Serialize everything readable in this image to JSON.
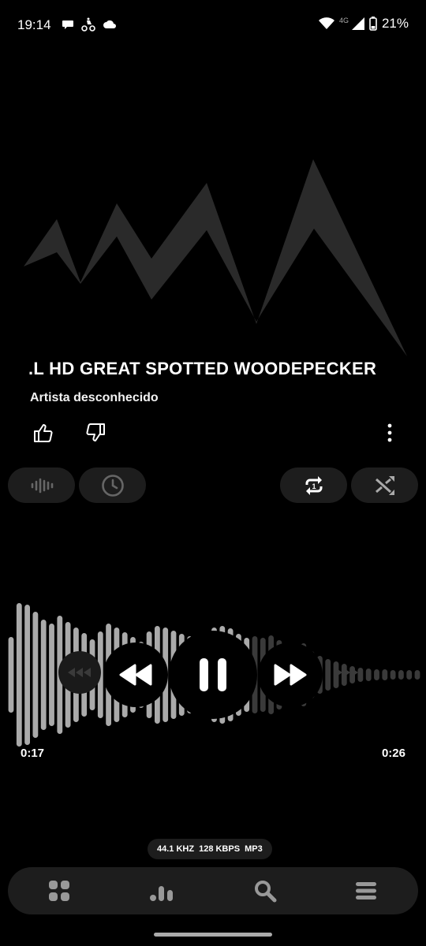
{
  "status_bar": {
    "time": "19:14",
    "left_icons": [
      "chat-bubble-icon",
      "delivery-rider-icon",
      "cloud-icon"
    ],
    "network": "4G",
    "battery": "21%",
    "right_icons": [
      "wifi-icon",
      "signal-icon",
      "battery-icon"
    ]
  },
  "track": {
    "title": ".L HD GREAT SPOTTED WOODEPECKER",
    "artist": "Artista desconhecido"
  },
  "actions": {
    "like_icon": "thumbs-up-icon",
    "dislike_icon": "thumbs-down-icon",
    "more_icon": "more-vertical-icon"
  },
  "options": [
    {
      "icon": "waveform-icon"
    },
    {
      "icon": "clock-icon"
    },
    {
      "icon": "repeat-one-icon"
    },
    {
      "icon": "shuffle-icon"
    }
  ],
  "playback": {
    "elapsed": "0:17",
    "total": "0:26",
    "progress": 0.65,
    "state": "playing"
  },
  "format": {
    "sample_rate": "44.1 KHZ",
    "bitrate": "128 KBPS",
    "codec": "MP3"
  },
  "bottom_nav": [
    {
      "icon": "grid-icon"
    },
    {
      "icon": "bar-chart-icon"
    },
    {
      "icon": "search-icon"
    },
    {
      "icon": "menu-icon"
    }
  ],
  "colors": {
    "background": "#000000",
    "surface": "#1d1d1d",
    "artwork": "#2a2a2a",
    "wave_played": "#aaaaaa",
    "wave_unplayed": "#3a3a3a"
  }
}
